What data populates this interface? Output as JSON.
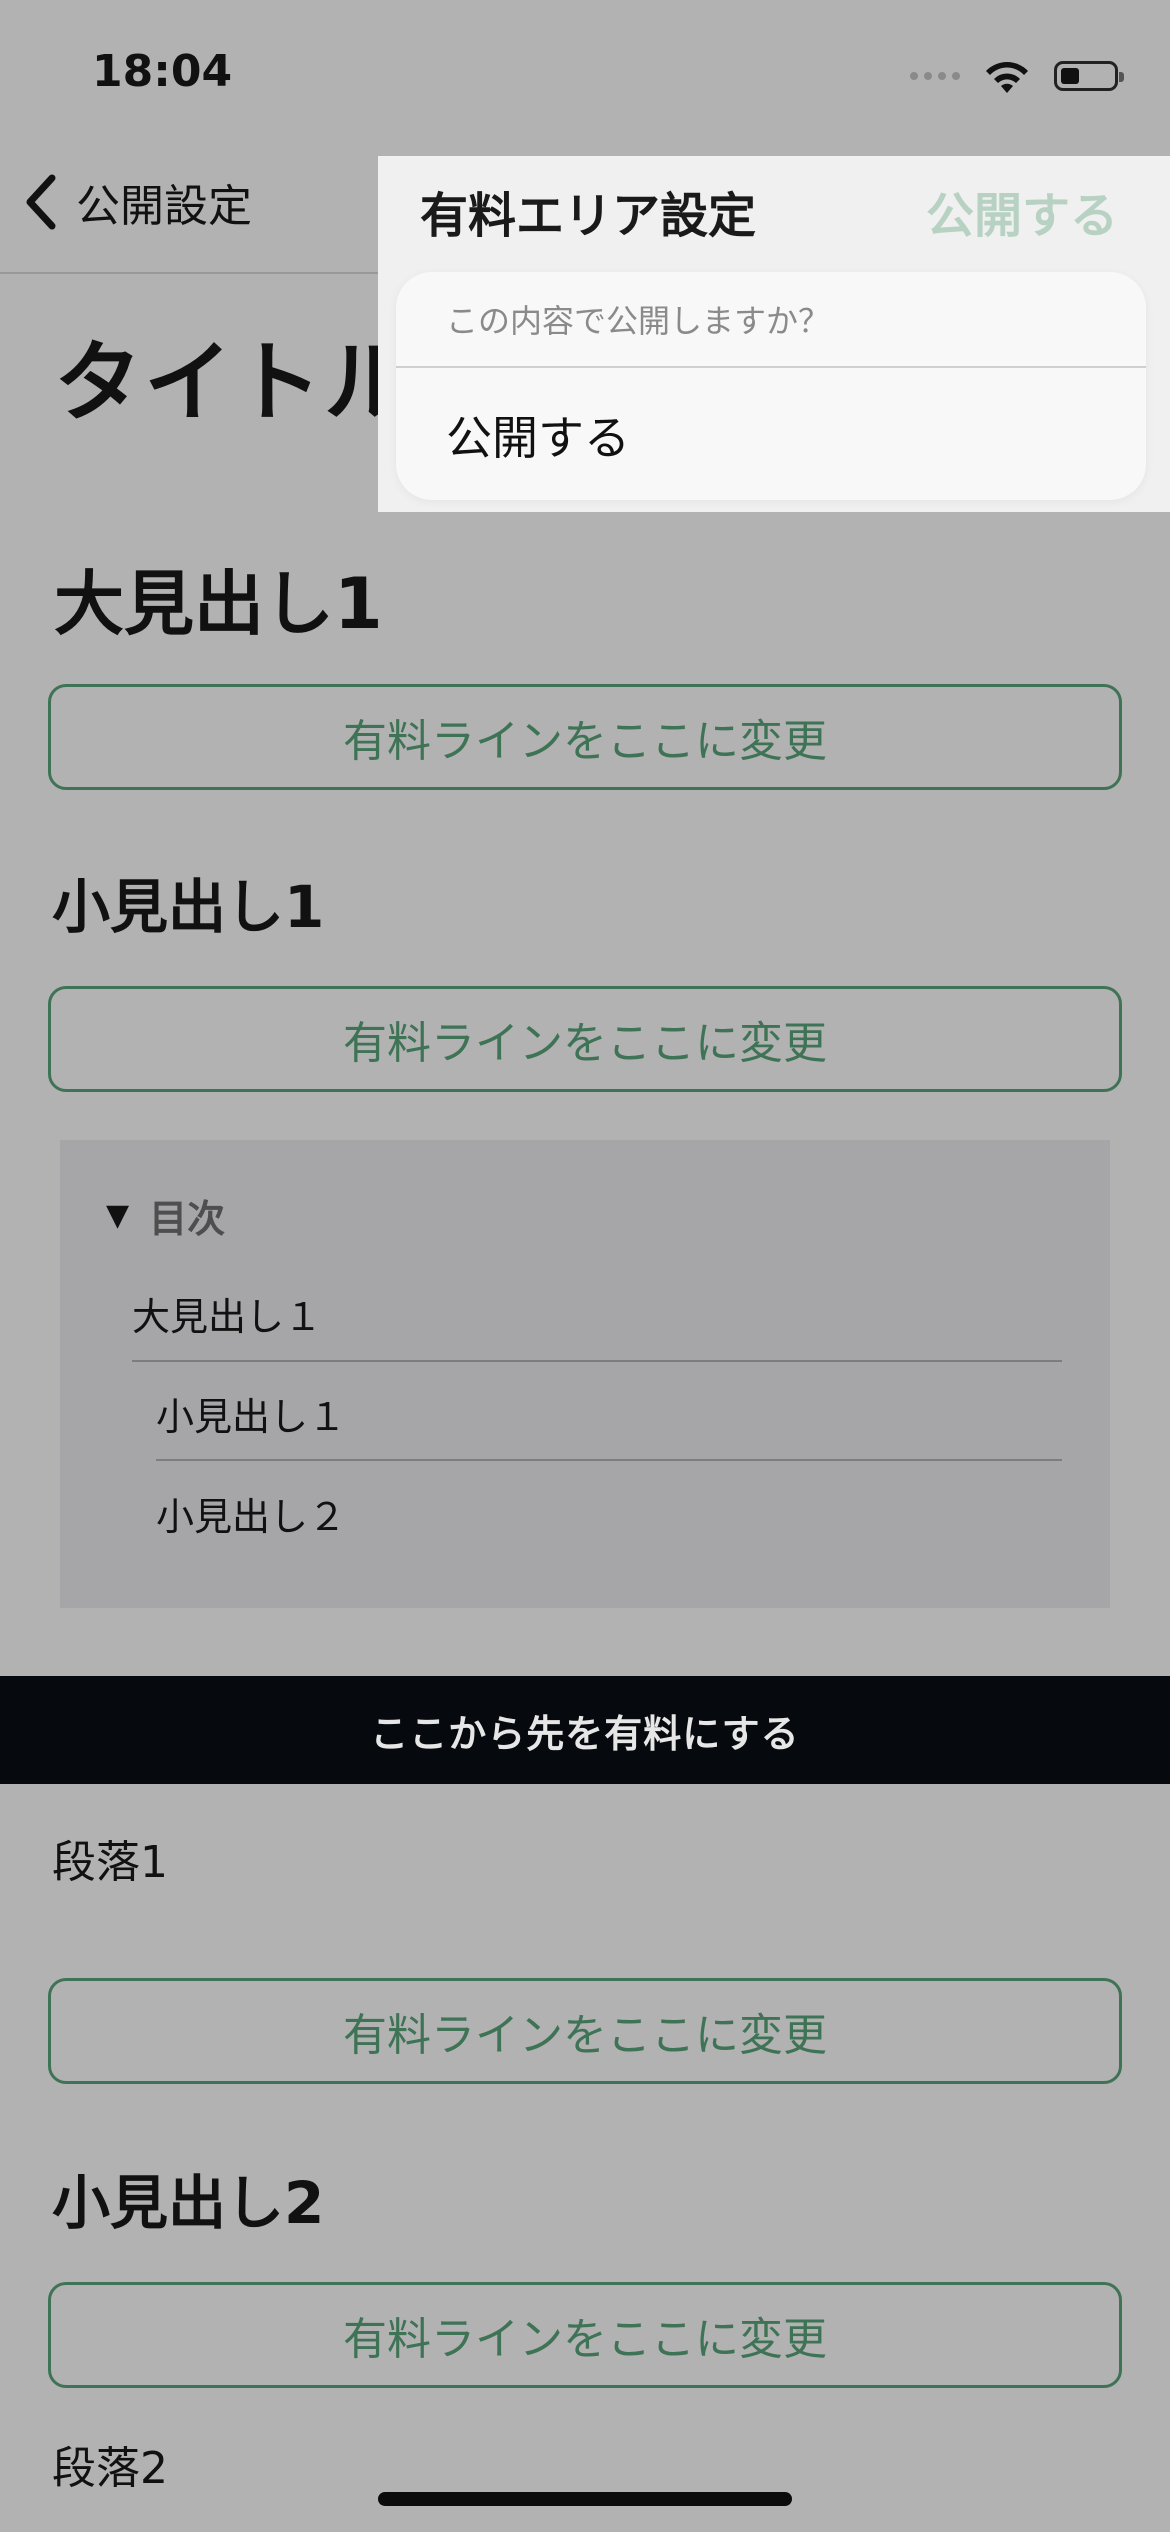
{
  "status_bar": {
    "time": "18:04"
  },
  "nav": {
    "back_label": "公開設定"
  },
  "popover": {
    "title": "有料エリア設定",
    "publish_label": "公開する",
    "sheet_message": "この内容で公開しますか？",
    "sheet_action": "公開する"
  },
  "article": {
    "title": "タイトル",
    "heading_large_1": "大見出し1",
    "heading_small_1": "小見出し1",
    "heading_small_2": "小見出し2",
    "paid_line_label": "有料ラインをここに変更",
    "paragraph_1": "段落1",
    "paragraph_2": "段落2"
  },
  "toc": {
    "marker": "▼",
    "label": "目次",
    "items": [
      "大見出し１",
      "小見出し１",
      "小見出し２"
    ]
  },
  "paid_bar": {
    "label": "ここから先を有料にする"
  },
  "colors": {
    "accent_green": "#3f7356",
    "publish_disabled": "#b7d2c3"
  }
}
